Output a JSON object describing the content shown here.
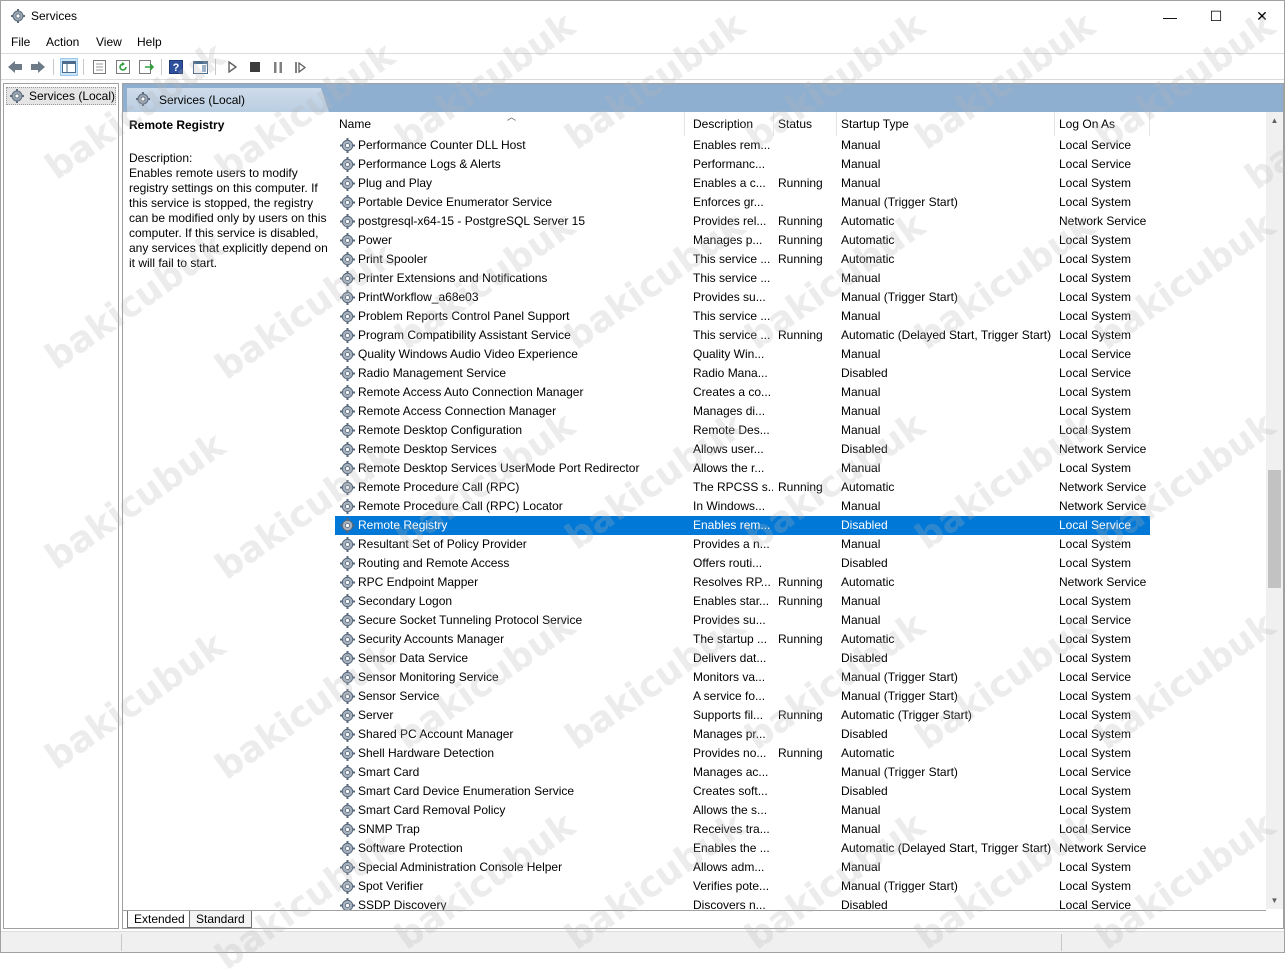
{
  "window": {
    "title": "Services",
    "minimize_glyph": "—",
    "maximize_glyph": "☐",
    "close_glyph": "✕"
  },
  "menu": [
    "File",
    "Action",
    "View",
    "Help"
  ],
  "toolbar": {
    "icons": [
      "back-arrow-icon",
      "forward-arrow-icon",
      "show-hide-console-tree-icon",
      "properties-icon",
      "refresh-icon",
      "export-list-icon",
      "help-icon",
      "show-hide-action-pane-icon",
      "start-service-icon",
      "stop-service-icon",
      "pause-service-icon",
      "restart-service-icon"
    ]
  },
  "tree": {
    "root_label": "Services (Local)"
  },
  "pane": {
    "title": "Services (Local)"
  },
  "description": {
    "service_name": "Remote Registry",
    "label": "Description:",
    "text": "Enables remote users to modify registry settings on this computer. If this service is stopped, the registry can be modified only by users on this computer. If this service is disabled, any services that explicitly depend on it will fail to start."
  },
  "columns": [
    "Name",
    "Description",
    "Status",
    "Startup Type",
    "Log On As"
  ],
  "selected_row": "Remote Registry",
  "rows": [
    {
      "name": "Performance Counter DLL Host",
      "desc": "Enables rem...",
      "status": "",
      "startup": "Manual",
      "logon": "Local Service"
    },
    {
      "name": "Performance Logs & Alerts",
      "desc": "Performanc...",
      "status": "",
      "startup": "Manual",
      "logon": "Local Service"
    },
    {
      "name": "Plug and Play",
      "desc": "Enables a c...",
      "status": "Running",
      "startup": "Manual",
      "logon": "Local System"
    },
    {
      "name": "Portable Device Enumerator Service",
      "desc": "Enforces gr...",
      "status": "",
      "startup": "Manual (Trigger Start)",
      "logon": "Local System"
    },
    {
      "name": "postgresql-x64-15 - PostgreSQL Server 15",
      "desc": "Provides rel...",
      "status": "Running",
      "startup": "Automatic",
      "logon": "Network Service"
    },
    {
      "name": "Power",
      "desc": "Manages p...",
      "status": "Running",
      "startup": "Automatic",
      "logon": "Local System"
    },
    {
      "name": "Print Spooler",
      "desc": "This service ...",
      "status": "Running",
      "startup": "Automatic",
      "logon": "Local System"
    },
    {
      "name": "Printer Extensions and Notifications",
      "desc": "This service ...",
      "status": "",
      "startup": "Manual",
      "logon": "Local System"
    },
    {
      "name": "PrintWorkflow_a68e03",
      "desc": "Provides su...",
      "status": "",
      "startup": "Manual (Trigger Start)",
      "logon": "Local System"
    },
    {
      "name": "Problem Reports Control Panel Support",
      "desc": "This service ...",
      "status": "",
      "startup": "Manual",
      "logon": "Local System"
    },
    {
      "name": "Program Compatibility Assistant Service",
      "desc": "This service ...",
      "status": "Running",
      "startup": "Automatic (Delayed Start, Trigger Start)",
      "logon": "Local System"
    },
    {
      "name": "Quality Windows Audio Video Experience",
      "desc": "Quality Win...",
      "status": "",
      "startup": "Manual",
      "logon": "Local Service"
    },
    {
      "name": "Radio Management Service",
      "desc": "Radio Mana...",
      "status": "",
      "startup": "Disabled",
      "logon": "Local Service"
    },
    {
      "name": "Remote Access Auto Connection Manager",
      "desc": "Creates a co...",
      "status": "",
      "startup": "Manual",
      "logon": "Local System"
    },
    {
      "name": "Remote Access Connection Manager",
      "desc": "Manages di...",
      "status": "",
      "startup": "Manual",
      "logon": "Local System"
    },
    {
      "name": "Remote Desktop Configuration",
      "desc": "Remote Des...",
      "status": "",
      "startup": "Manual",
      "logon": "Local System"
    },
    {
      "name": "Remote Desktop Services",
      "desc": "Allows user...",
      "status": "",
      "startup": "Disabled",
      "logon": "Network Service"
    },
    {
      "name": "Remote Desktop Services UserMode Port Redirector",
      "desc": "Allows the r...",
      "status": "",
      "startup": "Manual",
      "logon": "Local System"
    },
    {
      "name": "Remote Procedure Call (RPC)",
      "desc": "The RPCSS s...",
      "status": "Running",
      "startup": "Automatic",
      "logon": "Network Service"
    },
    {
      "name": "Remote Procedure Call (RPC) Locator",
      "desc": "In Windows...",
      "status": "",
      "startup": "Manual",
      "logon": "Network Service"
    },
    {
      "name": "Remote Registry",
      "desc": "Enables rem...",
      "status": "",
      "startup": "Disabled",
      "logon": "Local Service"
    },
    {
      "name": "Resultant Set of Policy Provider",
      "desc": "Provides a n...",
      "status": "",
      "startup": "Manual",
      "logon": "Local System"
    },
    {
      "name": "Routing and Remote Access",
      "desc": "Offers routi...",
      "status": "",
      "startup": "Disabled",
      "logon": "Local System"
    },
    {
      "name": "RPC Endpoint Mapper",
      "desc": "Resolves RP...",
      "status": "Running",
      "startup": "Automatic",
      "logon": "Network Service"
    },
    {
      "name": "Secondary Logon",
      "desc": "Enables star...",
      "status": "Running",
      "startup": "Manual",
      "logon": "Local System"
    },
    {
      "name": "Secure Socket Tunneling Protocol Service",
      "desc": "Provides su...",
      "status": "",
      "startup": "Manual",
      "logon": "Local Service"
    },
    {
      "name": "Security Accounts Manager",
      "desc": "The startup ...",
      "status": "Running",
      "startup": "Automatic",
      "logon": "Local System"
    },
    {
      "name": "Sensor Data Service",
      "desc": "Delivers dat...",
      "status": "",
      "startup": "Disabled",
      "logon": "Local System"
    },
    {
      "name": "Sensor Monitoring Service",
      "desc": "Monitors va...",
      "status": "",
      "startup": "Manual (Trigger Start)",
      "logon": "Local Service"
    },
    {
      "name": "Sensor Service",
      "desc": "A service fo...",
      "status": "",
      "startup": "Manual (Trigger Start)",
      "logon": "Local System"
    },
    {
      "name": "Server",
      "desc": "Supports fil...",
      "status": "Running",
      "startup": "Automatic (Trigger Start)",
      "logon": "Local System"
    },
    {
      "name": "Shared PC Account Manager",
      "desc": "Manages pr...",
      "status": "",
      "startup": "Disabled",
      "logon": "Local System"
    },
    {
      "name": "Shell Hardware Detection",
      "desc": "Provides no...",
      "status": "Running",
      "startup": "Automatic",
      "logon": "Local System"
    },
    {
      "name": "Smart Card",
      "desc": "Manages ac...",
      "status": "",
      "startup": "Manual (Trigger Start)",
      "logon": "Local Service"
    },
    {
      "name": "Smart Card Device Enumeration Service",
      "desc": "Creates soft...",
      "status": "",
      "startup": "Disabled",
      "logon": "Local System"
    },
    {
      "name": "Smart Card Removal Policy",
      "desc": "Allows the s...",
      "status": "",
      "startup": "Manual",
      "logon": "Local System"
    },
    {
      "name": "SNMP Trap",
      "desc": "Receives tra...",
      "status": "",
      "startup": "Manual",
      "logon": "Local Service"
    },
    {
      "name": "Software Protection",
      "desc": "Enables the ...",
      "status": "",
      "startup": "Automatic (Delayed Start, Trigger Start)",
      "logon": "Network Service"
    },
    {
      "name": "Special Administration Console Helper",
      "desc": "Allows adm...",
      "status": "",
      "startup": "Manual",
      "logon": "Local System"
    },
    {
      "name": "Spot Verifier",
      "desc": "Verifies pote...",
      "status": "",
      "startup": "Manual (Trigger Start)",
      "logon": "Local System"
    },
    {
      "name": "SSDP Discovery",
      "desc": "Discovers n...",
      "status": "",
      "startup": "Disabled",
      "logon": "Local Service"
    }
  ],
  "tabs": [
    "Extended",
    "Standard"
  ],
  "watermark_text": "bakicubuk",
  "colors": {
    "selection": "#0078d7",
    "pane_header": "#8fafd0"
  }
}
